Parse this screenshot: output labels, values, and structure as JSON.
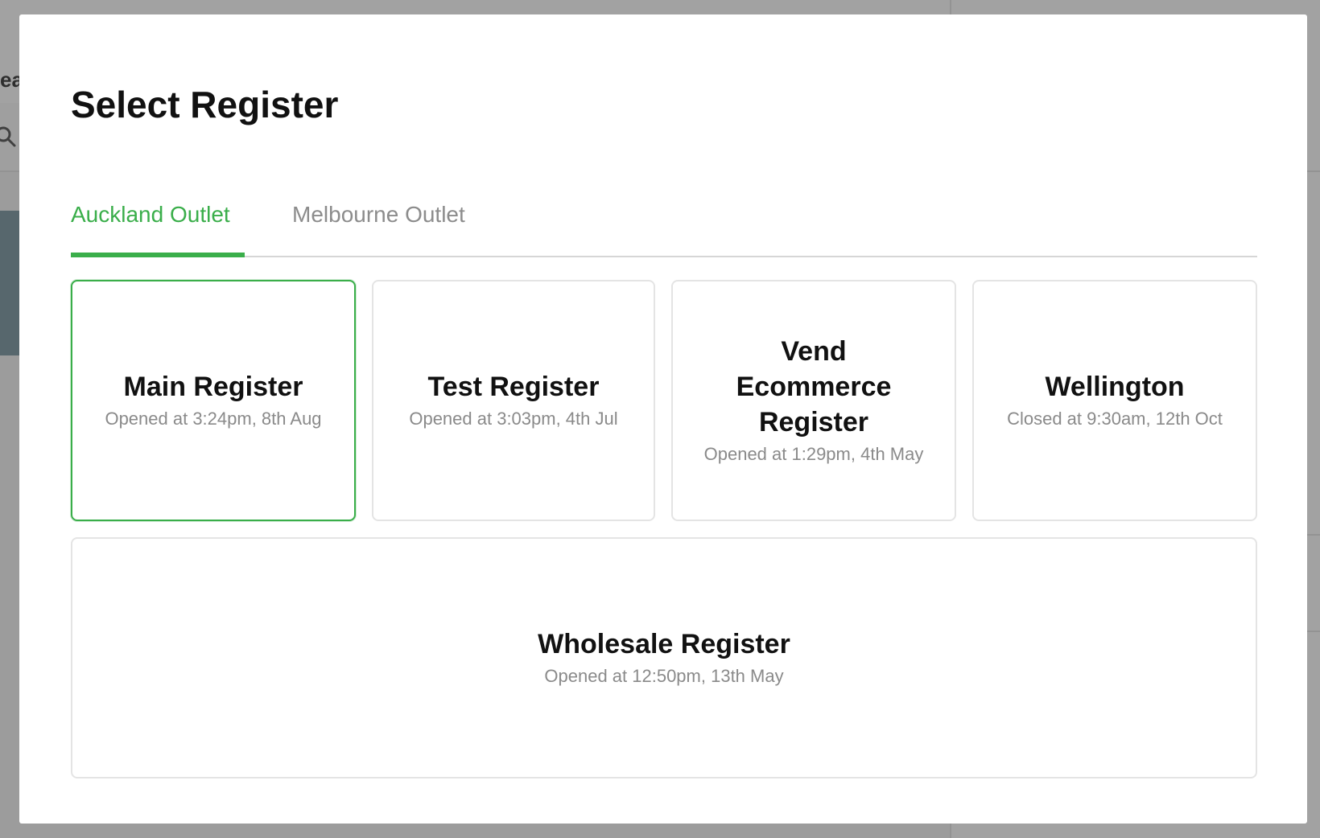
{
  "background": {
    "title_fragment": "ear"
  },
  "modal": {
    "title": "Select Register",
    "accent_color": "#3aae4a",
    "tabs": [
      {
        "label": "Auckland Outlet",
        "active": true
      },
      {
        "label": "Melbourne Outlet",
        "active": false
      }
    ],
    "registers": [
      {
        "name": "Main Register",
        "status": "Opened at 3:24pm, 8th Aug",
        "selected": true
      },
      {
        "name": "Test Register",
        "status": "Opened at 3:03pm, 4th Jul",
        "selected": false
      },
      {
        "name": "Vend Ecommerce Register",
        "status": "Opened at 1:29pm, 4th May",
        "selected": false
      },
      {
        "name": "Wellington",
        "status": "Closed at 9:30am, 12th Oct",
        "selected": false
      },
      {
        "name": "Wholesale Register",
        "status": "Opened at 12:50pm, 13th May",
        "selected": false
      }
    ]
  }
}
